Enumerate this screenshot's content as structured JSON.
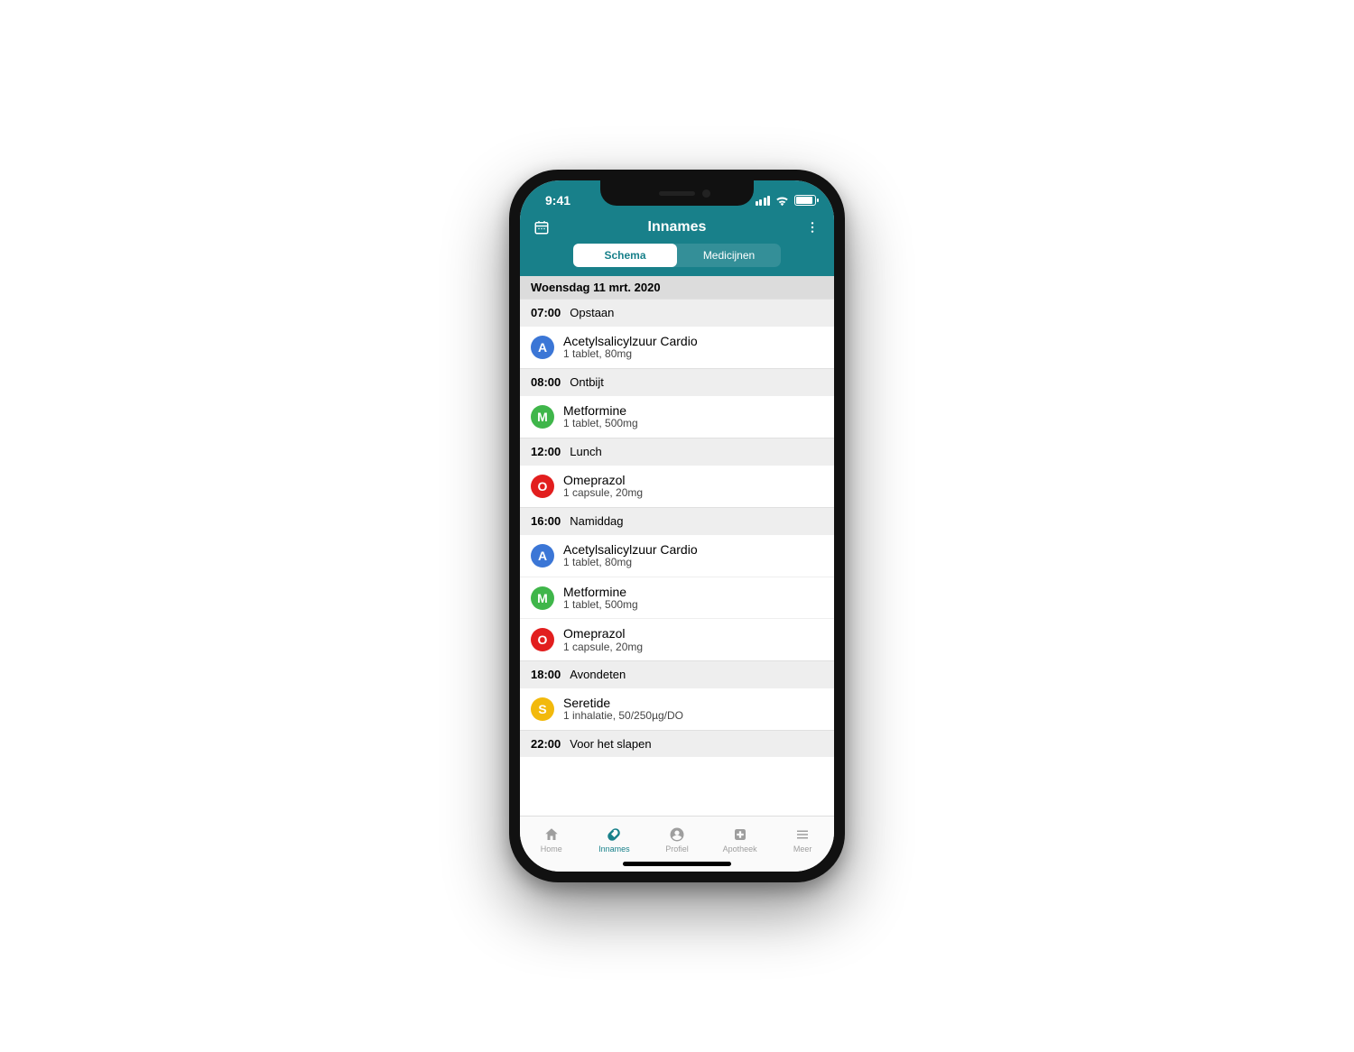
{
  "status": {
    "time": "9:41"
  },
  "header": {
    "title": "Innames",
    "seg_schema": "Schema",
    "seg_medicijnen": "Medicijnen"
  },
  "date": "Woensdag 11 mrt. 2020",
  "slots": [
    {
      "time": "07:00",
      "label": "Opstaan",
      "meds": [
        {
          "letter": "A",
          "color": "#3b76d6",
          "name": "Acetylsalicylzuur Cardio",
          "dose": "1 tablet, 80mg"
        }
      ]
    },
    {
      "time": "08:00",
      "label": "Ontbijt",
      "meds": [
        {
          "letter": "M",
          "color": "#3fb64a",
          "name": "Metformine",
          "dose": "1 tablet, 500mg"
        }
      ]
    },
    {
      "time": "12:00",
      "label": "Lunch",
      "meds": [
        {
          "letter": "O",
          "color": "#e21e1e",
          "name": "Omeprazol",
          "dose": "1 capsule, 20mg"
        }
      ]
    },
    {
      "time": "16:00",
      "label": "Namiddag",
      "meds": [
        {
          "letter": "A",
          "color": "#3b76d6",
          "name": "Acetylsalicylzuur Cardio",
          "dose": "1 tablet, 80mg"
        },
        {
          "letter": "M",
          "color": "#3fb64a",
          "name": "Metformine",
          "dose": "1 tablet, 500mg"
        },
        {
          "letter": "O",
          "color": "#e21e1e",
          "name": "Omeprazol",
          "dose": "1 capsule, 20mg"
        }
      ]
    },
    {
      "time": "18:00",
      "label": "Avondeten",
      "meds": [
        {
          "letter": "S",
          "color": "#f2b90c",
          "name": "Seretide",
          "dose": "1 inhalatie, 50/250µg/DO"
        }
      ]
    },
    {
      "time": "22:00",
      "label": "Voor het slapen",
      "meds": []
    }
  ],
  "tabs": {
    "home": "Home",
    "innames": "Innames",
    "profiel": "Profiel",
    "apotheek": "Apotheek",
    "meer": "Meer"
  }
}
